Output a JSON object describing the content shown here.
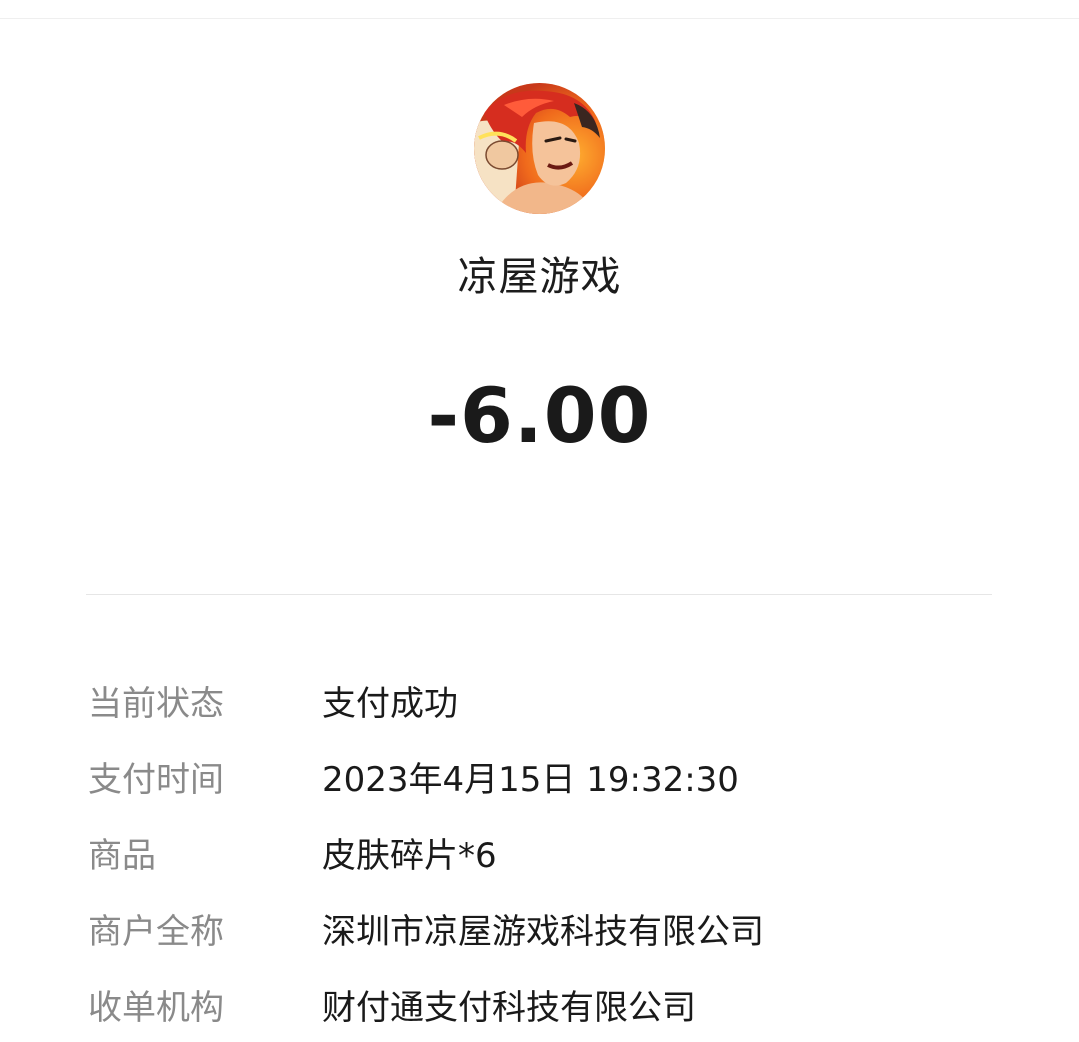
{
  "merchant": {
    "avatar_icon": "game-character-avatar",
    "name": "凉屋游戏"
  },
  "amount": "-6.00",
  "details": [
    {
      "label": "当前状态",
      "value": "支付成功"
    },
    {
      "label": "支付时间",
      "value": "2023年4月15日 19:32:30"
    },
    {
      "label": "商品",
      "value": "皮肤碎片*6"
    },
    {
      "label": "商户全称",
      "value": "深圳市凉屋游戏科技有限公司"
    },
    {
      "label": "收单机构",
      "value": "财付通支付科技有限公司"
    }
  ],
  "colors": {
    "background": "#ffffff",
    "label": "#8a8a8a",
    "text": "#1a1a1a",
    "divider": "#e6e6e6"
  }
}
